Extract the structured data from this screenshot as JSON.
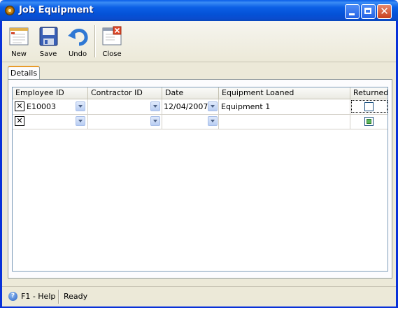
{
  "window": {
    "title": "Job Equipment"
  },
  "toolbar": {
    "new_label": "New",
    "save_label": "Save",
    "undo_label": "Undo",
    "close_label": "Close"
  },
  "tabs": [
    {
      "label": "Details",
      "selected": true
    }
  ],
  "grid": {
    "columns": [
      "Employee ID",
      "Contractor ID",
      "Date",
      "Equipment Loaned",
      "Returned"
    ],
    "rows": [
      {
        "employee_id": "E10003",
        "contractor_id": "",
        "date": "12/04/2007",
        "equipment_loaned": "Equipment 1",
        "returned": false
      },
      {
        "employee_id": "",
        "contractor_id": "",
        "date": "",
        "equipment_loaned": "",
        "returned": true
      }
    ]
  },
  "status": {
    "help_text": "F1 - Help",
    "state_text": "Ready"
  },
  "icons": {
    "title": "app-gear-icon",
    "new": "new-document-icon",
    "save": "floppy-disk-icon",
    "undo": "undo-arrow-icon",
    "close": "close-document-icon",
    "help": "help-icon",
    "delete_row": "delete-row-icon",
    "dropdown": "chevron-down-icon"
  },
  "colors": {
    "title_bar": "#0451d6",
    "close_button": "#c8401e",
    "tab_accent": "#e89c2c",
    "grid_border": "#7f9db9",
    "checkbox_fill": "#5cb85c"
  }
}
